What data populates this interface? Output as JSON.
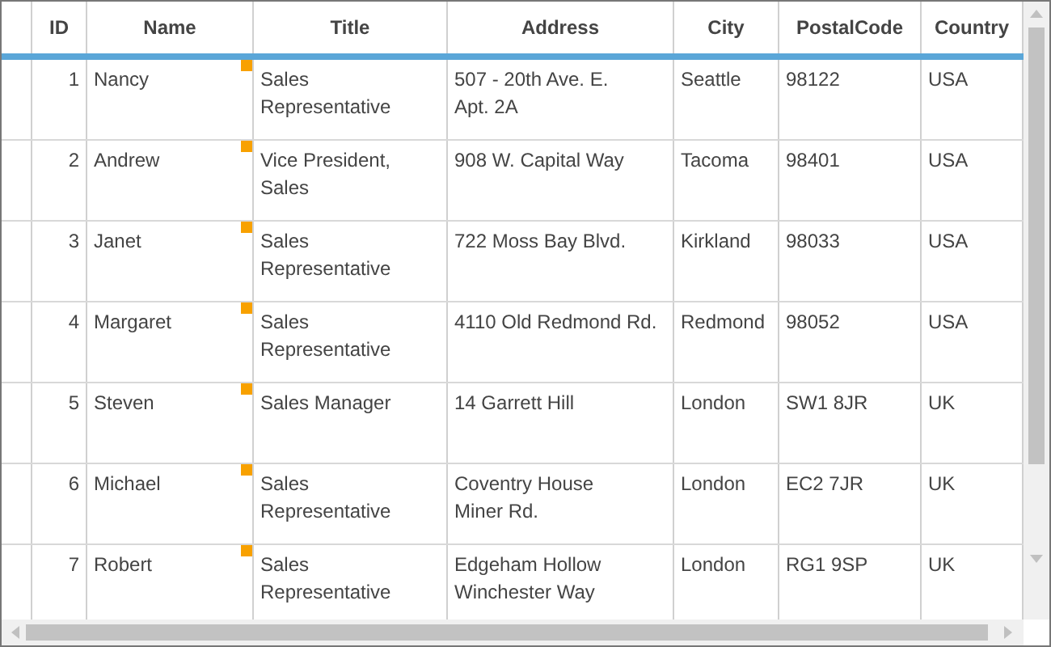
{
  "table": {
    "columns": [
      "ID",
      "Name",
      "Title",
      "Address",
      "City",
      "PostalCode",
      "Country"
    ],
    "rows": [
      {
        "cells": [
          "1",
          "Nancy",
          "Sales Representative",
          "507 - 20th Ave. E.\nApt. 2A",
          "Seattle",
          "98122",
          "USA"
        ]
      },
      {
        "cells": [
          "2",
          "Andrew",
          "Vice President, Sales",
          "908 W. Capital Way",
          "Tacoma",
          "98401",
          "USA"
        ]
      },
      {
        "cells": [
          "3",
          "Janet",
          "Sales Representative",
          "722 Moss Bay Blvd.",
          "Kirkland",
          "98033",
          "USA"
        ]
      },
      {
        "cells": [
          "4",
          "Margaret",
          "Sales Representative",
          "4110 Old Redmond Rd.",
          "Redmond",
          "98052",
          "USA"
        ]
      },
      {
        "cells": [
          "5",
          "Steven",
          "Sales Manager",
          "14 Garrett Hill",
          "London",
          "SW1 8JR",
          "UK"
        ]
      },
      {
        "cells": [
          "6",
          "Michael",
          "Sales Representative",
          "Coventry House\nMiner Rd.",
          "London",
          "EC2 7JR",
          "UK"
        ]
      },
      {
        "cells": [
          "7",
          "Robert",
          "Sales Representative",
          "Edgeham Hollow\nWinchester Way",
          "London",
          "RG1 9SP",
          "UK"
        ]
      }
    ]
  }
}
